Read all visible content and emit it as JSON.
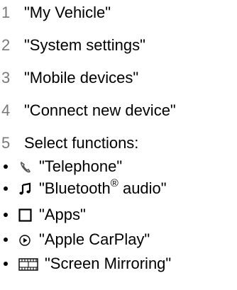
{
  "steps": [
    {
      "number": "1",
      "text": "\"My Vehicle\""
    },
    {
      "number": "2",
      "text": "\"System settings\""
    },
    {
      "number": "3",
      "text": "\"Mobile devices\""
    },
    {
      "number": "4",
      "text": "\"Connect new device\""
    },
    {
      "number": "5",
      "text": "Select functions:"
    }
  ],
  "functions": [
    {
      "icon": "telephone-icon",
      "text": "\"Telephone\""
    },
    {
      "icon": "music-note-icon",
      "text_before": "\"Bluetooth",
      "superscript": "®",
      "text_after": " audio\""
    },
    {
      "icon": "apps-square-icon",
      "text": "\"Apps\""
    },
    {
      "icon": "play-circle-icon",
      "text": "\"Apple CarPlay\""
    },
    {
      "icon": "film-strip-icon",
      "text": "\"Screen Mirroring\""
    }
  ],
  "colors": {
    "step_number": "#7a7a7a",
    "text": "#000000"
  }
}
